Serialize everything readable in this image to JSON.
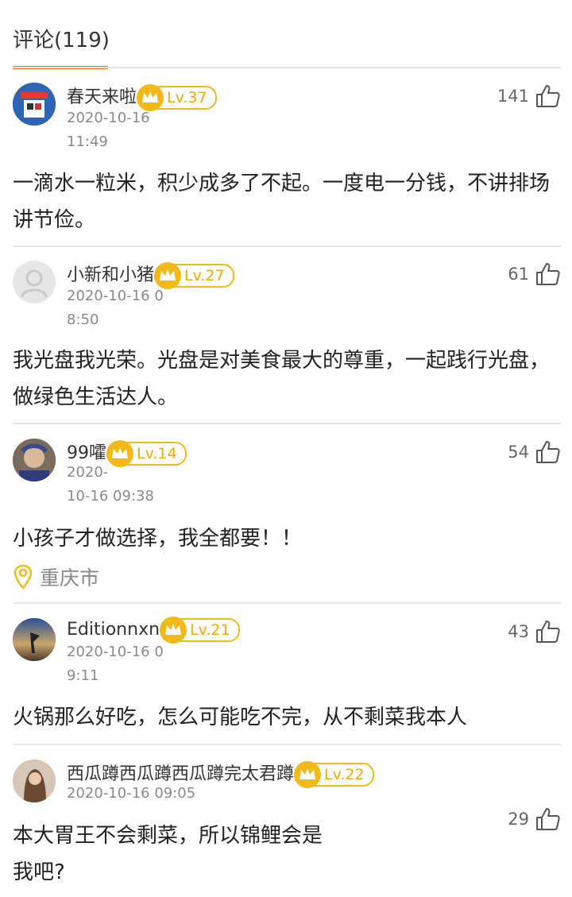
{
  "header": {
    "title": "评论(119)"
  },
  "comments": [
    {
      "user": "春天来啦",
      "level": "Lv.37",
      "date": "2020-10-16\n11:49",
      "likes": "141",
      "text": "一滴水一粒米，积少成多了不起。一度电一分钱，不讲排场讲节俭。"
    },
    {
      "user": "小新和小猪",
      "level": "Lv.27",
      "date": "2020-10-16 0\n8:50",
      "likes": "61",
      "text": "我光盘我光荣。光盘是对美食最大的尊重，一起践行光盘，做绿色生活达人。"
    },
    {
      "user": "99嚯",
      "level": "Lv.14",
      "date": "2020-\n10-16 09:38",
      "likes": "54",
      "text": "小孩子才做选择，我全都要！！",
      "location": "重庆市"
    },
    {
      "user": "Editionnxn",
      "level": "Lv.21",
      "date": "2020-10-16 0\n9:11",
      "likes": "43",
      "text": "火锅那么好吃，怎么可能吃不完，从不剩菜我本人"
    },
    {
      "user": "西瓜蹲西瓜蹲西瓜蹲完太君蹲",
      "level": "Lv.22",
      "date": "2020-10-16 09:05",
      "likes": "29",
      "text": "本大胃王不会剩菜，所以锦鲤会是\n我吧?"
    }
  ],
  "colors": {
    "accent": "#f26b1d",
    "level_gold": "#f2b91a"
  }
}
